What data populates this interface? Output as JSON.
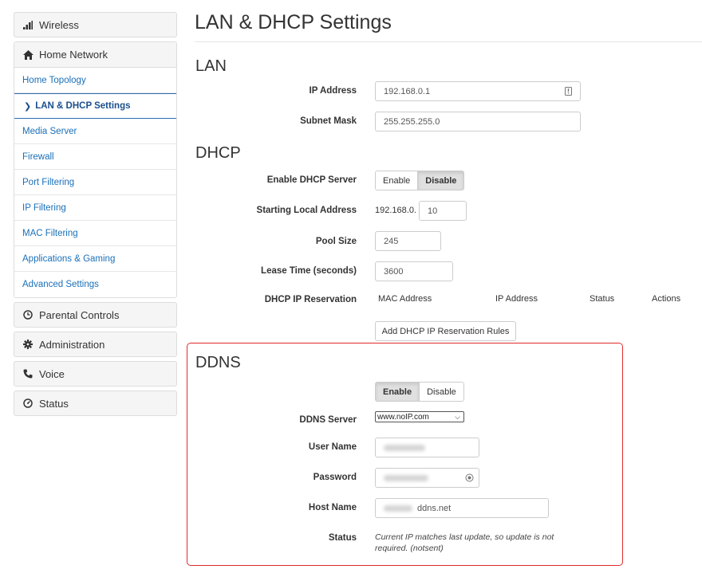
{
  "sidebar": {
    "wireless": "Wireless",
    "home_network": "Home Network",
    "items": [
      "Home Topology",
      "LAN & DHCP Settings",
      "Media Server",
      "Firewall",
      "Port Filtering",
      "IP Filtering",
      "MAC Filtering",
      "Applications & Gaming",
      "Advanced Settings"
    ],
    "active_index": 1,
    "parental_controls": "Parental Controls",
    "administration": "Administration",
    "voice": "Voice",
    "status": "Status"
  },
  "page": {
    "title": "LAN & DHCP Settings"
  },
  "lan": {
    "title": "LAN",
    "ip_label": "IP Address",
    "ip_value": "192.168.0.1",
    "subnet_label": "Subnet Mask",
    "subnet_value": "255.255.255.0"
  },
  "dhcp": {
    "title": "DHCP",
    "enable_label": "Enable DHCP Server",
    "enable_btn": "Enable",
    "disable_btn": "Disable",
    "selected": "Disable",
    "start_label": "Starting Local Address",
    "start_prefix": "192.168.0.",
    "start_value": "10",
    "pool_label": "Pool Size",
    "pool_value": "245",
    "lease_label": "Lease Time (seconds)",
    "lease_value": "3600",
    "reservation_label": "DHCP IP Reservation",
    "reservation_columns": [
      "MAC Address",
      "IP Address",
      "Status",
      "Actions"
    ],
    "add_rules_btn": "Add DHCP IP Reservation Rules"
  },
  "ddns": {
    "title": "DDNS",
    "enable_btn": "Enable",
    "disable_btn": "Disable",
    "selected": "Enable",
    "server_label": "DDNS Server",
    "server_value": "www.noIP.com",
    "username_label": "User Name",
    "password_label": "Password",
    "hostname_label": "Host Name",
    "hostname_suffix": "ddns.net",
    "status_label": "Status",
    "status_text": "Current IP matches last update, so update is not required. (notsent)"
  },
  "colors": {
    "highlight_border": "#e02b2b",
    "link": "#1a6fb8"
  }
}
